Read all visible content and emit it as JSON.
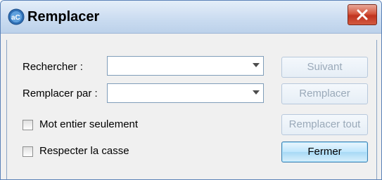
{
  "window": {
    "title": "Remplacer",
    "close_icon": "close-icon"
  },
  "form": {
    "search_label": "Rechercher :",
    "search_value": "",
    "replace_label": "Remplacer par :",
    "replace_value": "",
    "whole_word_label": "Mot entier seulement",
    "whole_word_checked": false,
    "match_case_label": "Respecter la casse",
    "match_case_checked": false
  },
  "buttons": {
    "next": "Suivant",
    "replace": "Remplacer",
    "replace_all": "Remplacer tout",
    "close": "Fermer"
  },
  "colors": {
    "accent": "#3c7fb1",
    "close_button": "#c0341f",
    "disabled_text": "#9aa9b9"
  }
}
